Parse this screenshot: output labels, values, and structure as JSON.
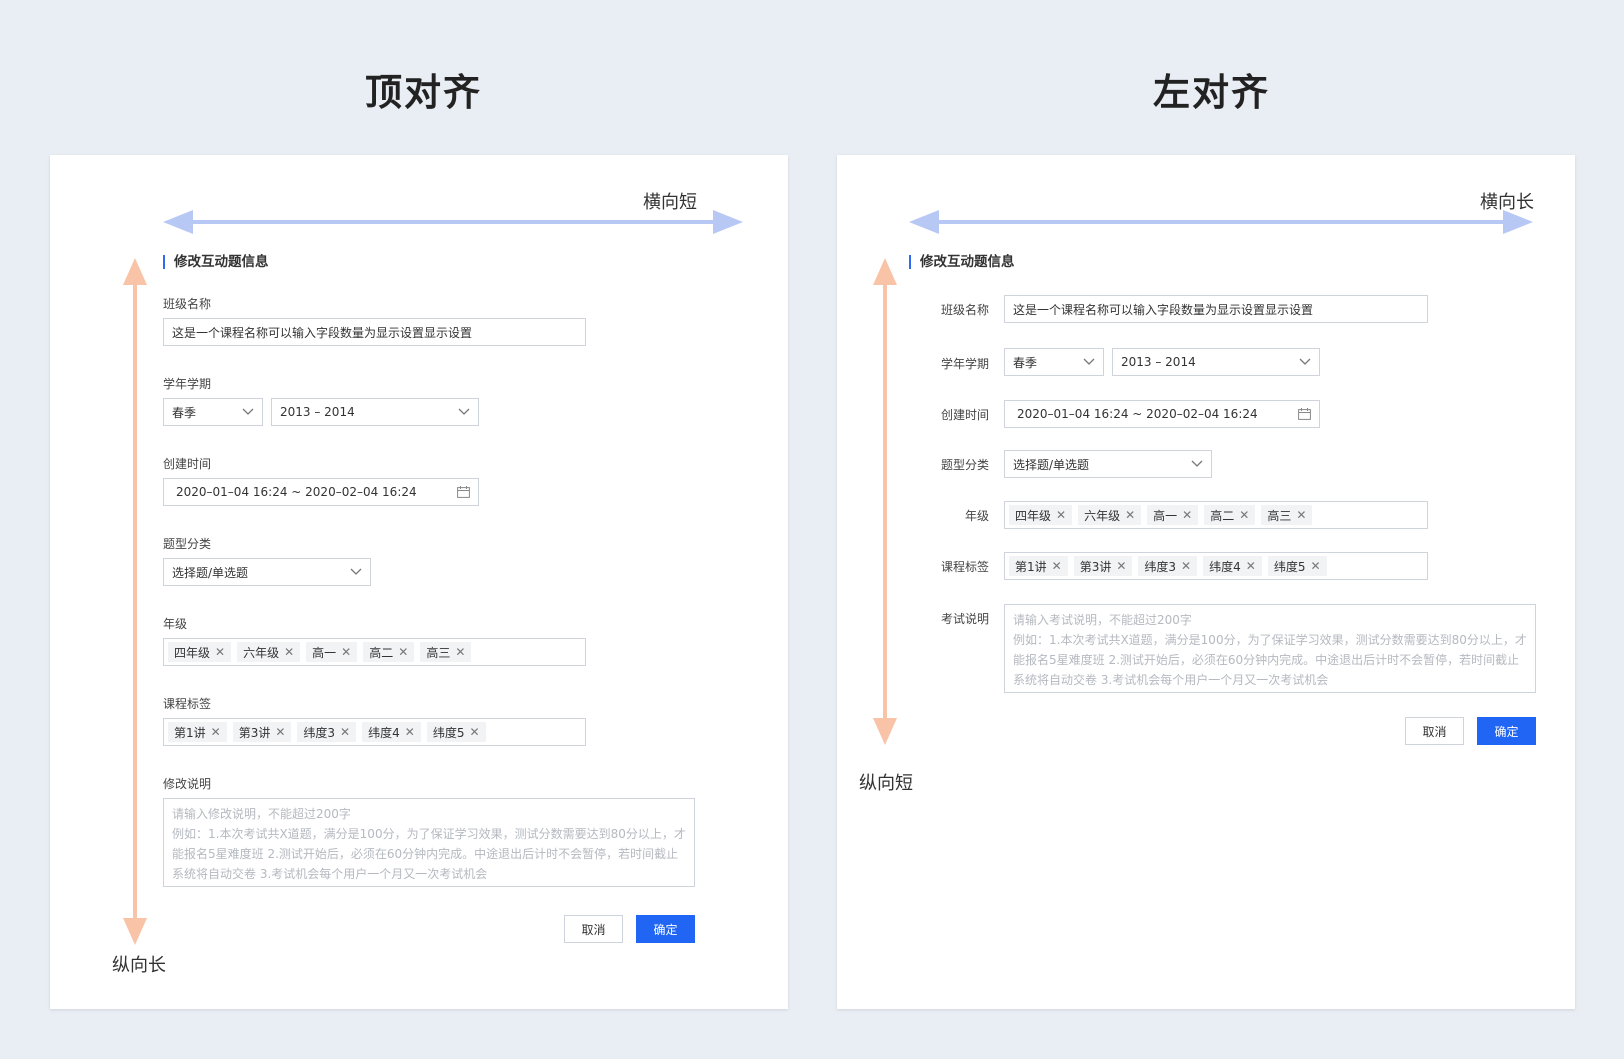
{
  "headings": {
    "left": "顶对齐",
    "right": "左对齐"
  },
  "axis": {
    "left_h": "横向短",
    "left_v": "纵向长",
    "right_h": "横向长",
    "right_v": "纵向短"
  },
  "colors": {
    "h_arrow": "#b8c8f4",
    "v_arrow": "#f8c3a6",
    "accent": "#2165f5",
    "page_bg": "#e9edf4"
  },
  "form": {
    "section_title": "修改互动题信息",
    "class_name": {
      "label": "班级名称",
      "value": "这是一个课程名称可以输入字段数量为显示设置显示设置"
    },
    "term": {
      "label": "学年学期",
      "season": "春季",
      "year": "2013 – 2014"
    },
    "created": {
      "label": "创建时间",
      "value": "2020–01–04 16:24 ~ 2020–02–04 16:24"
    },
    "type": {
      "label": "题型分类",
      "value": "选择题/单选题"
    },
    "grade": {
      "label": "年级",
      "tags": [
        "四年级",
        "六年级",
        "高一",
        "高二",
        "高三"
      ]
    },
    "course_tags": {
      "label": "课程标签",
      "tags": [
        "第1讲",
        "第3讲",
        "纬度3",
        "纬度4",
        "纬度5"
      ]
    },
    "desc_left": {
      "label": "修改说明",
      "lines": [
        "请输入修改说明，不能超过200字",
        "例如：1.本次考试共X道题，满分是100分，为了保证学习效果，测试分数需要达到80分以上，才",
        "能报名5星难度班  2.测试开始后，必须在60分钟内完成。中途退出后计时不会暂停，若时间截止",
        "系统将自动交卷  3.考试机会每个用户一个月又一次考试机会"
      ]
    },
    "desc_right": {
      "label": "考试说明",
      "lines": [
        "请输入考试说明，不能超过200字",
        "例如：1.本次考试共X道题，满分是100分，为了保证学习效果，测试分数需要达到80分以上，才",
        "能报名5星难度班  2.测试开始后，必须在60分钟内完成。中途退出后计时不会暂停，若时间截止",
        "系统将自动交卷  3.考试机会每个用户一个月又一次考试机会"
      ]
    },
    "cancel": "取消",
    "ok": "确定"
  }
}
